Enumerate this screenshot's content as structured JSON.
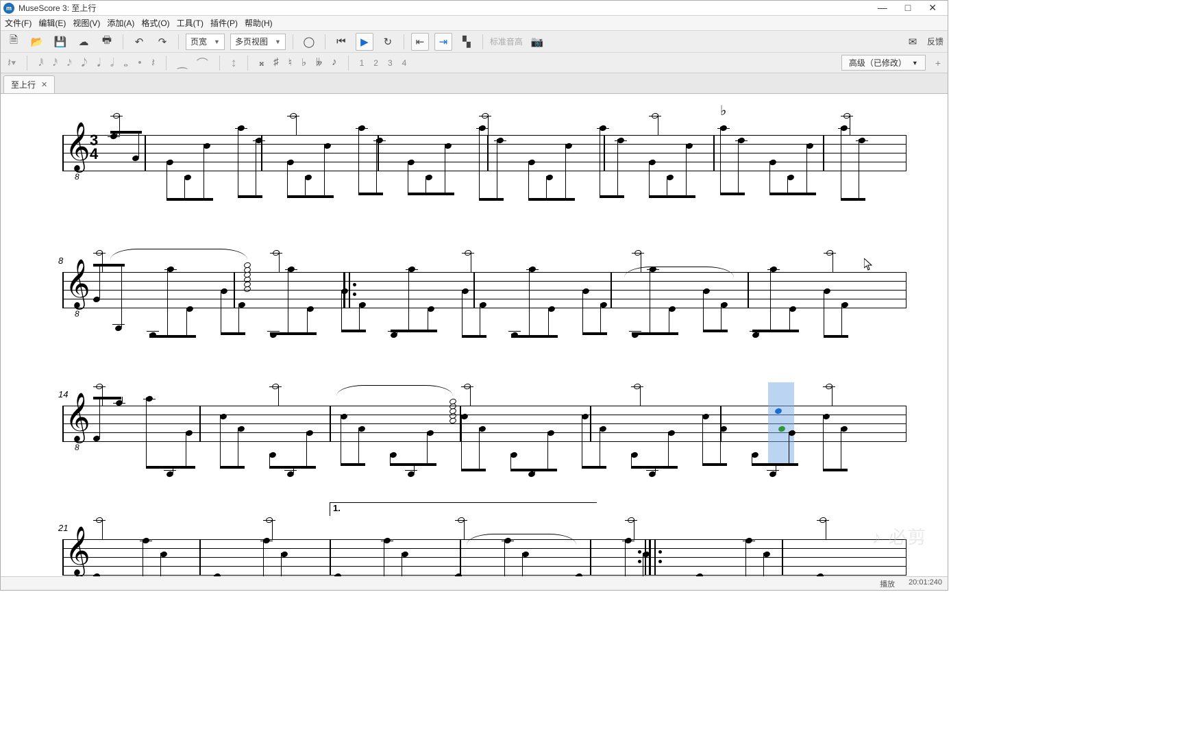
{
  "window": {
    "app_prefix": "MuseScore 3:",
    "doc": "至上行"
  },
  "winbtns": {
    "min": "—",
    "max": "□",
    "close": "✕"
  },
  "menus": [
    "文件(F)",
    "编辑(E)",
    "视图(V)",
    "添加(A)",
    "格式(O)",
    "工具(T)",
    "插件(P)",
    "帮助(H)"
  ],
  "toolbar": {
    "zoom_combo": "页宽",
    "view_combo": "多页视图",
    "concert_pitch": "标准音高",
    "feedback": "反馈"
  },
  "toolbar2": {
    "voices": [
      "1",
      "2",
      "3",
      "4"
    ],
    "mode": "高级（已修改）"
  },
  "tab": {
    "label": "至上行",
    "close": "✕"
  },
  "score": {
    "systems": [
      {
        "measure_number": "",
        "clef": "𝄞",
        "time_top": "3",
        "time_bot": "4"
      },
      {
        "measure_number": "8"
      },
      {
        "measure_number": "14"
      },
      {
        "measure_number": "21",
        "volta": "1."
      }
    ],
    "flat_glyph": "♭"
  },
  "status": {
    "mode": "播放",
    "pos": "20:01:240"
  },
  "watermark": "必剪"
}
